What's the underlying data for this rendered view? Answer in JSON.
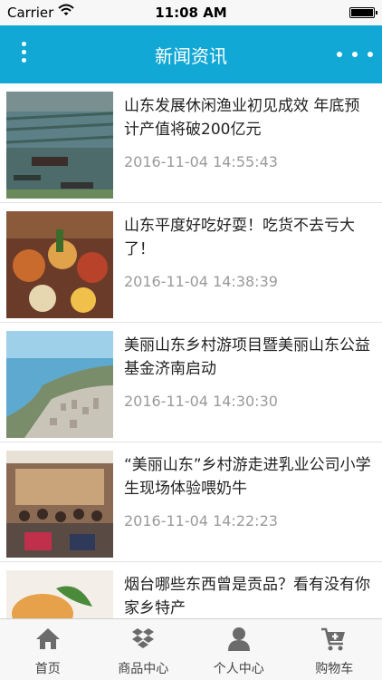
{
  "status_bar": {
    "carrier": "Carrier",
    "time": "11:08 AM"
  },
  "nav": {
    "title": "新闻资讯"
  },
  "news": [
    {
      "title": "山东发展休闲渔业初见成效 年底预计产值将破200亿元",
      "date": "2016-11-04 14:55:43",
      "image": "fishing-farm-photo"
    },
    {
      "title": "山东平度好吃好耍！吃货不去亏大了！",
      "date": "2016-11-04 14:38:39",
      "image": "food-feast-photo"
    },
    {
      "title": "美丽山东乡村游项目暨美丽山东公益基金济南启动",
      "date": "2016-11-04 14:30:30",
      "image": "coastal-city-photo"
    },
    {
      "title": "“美丽山东”乡村游走进乳业公司小学生现场体验喂奶牛",
      "date": "2016-11-04 14:22:23",
      "image": "event-hall-photo"
    },
    {
      "title": "烟台哪些东西曾是贡品？看有没有你家乡特产",
      "date": "",
      "image": "dish-photo"
    }
  ],
  "tabs": [
    {
      "label": "首页",
      "icon": "home-icon"
    },
    {
      "label": "商品中心",
      "icon": "dropbox-icon"
    },
    {
      "label": "个人中心",
      "icon": "user-icon"
    },
    {
      "label": "购物车",
      "icon": "cart-icon"
    }
  ],
  "colors": {
    "nav_bar": "#12a8d5",
    "tab_icon": "#6b6b6b",
    "date_text": "#9a9a9a"
  }
}
